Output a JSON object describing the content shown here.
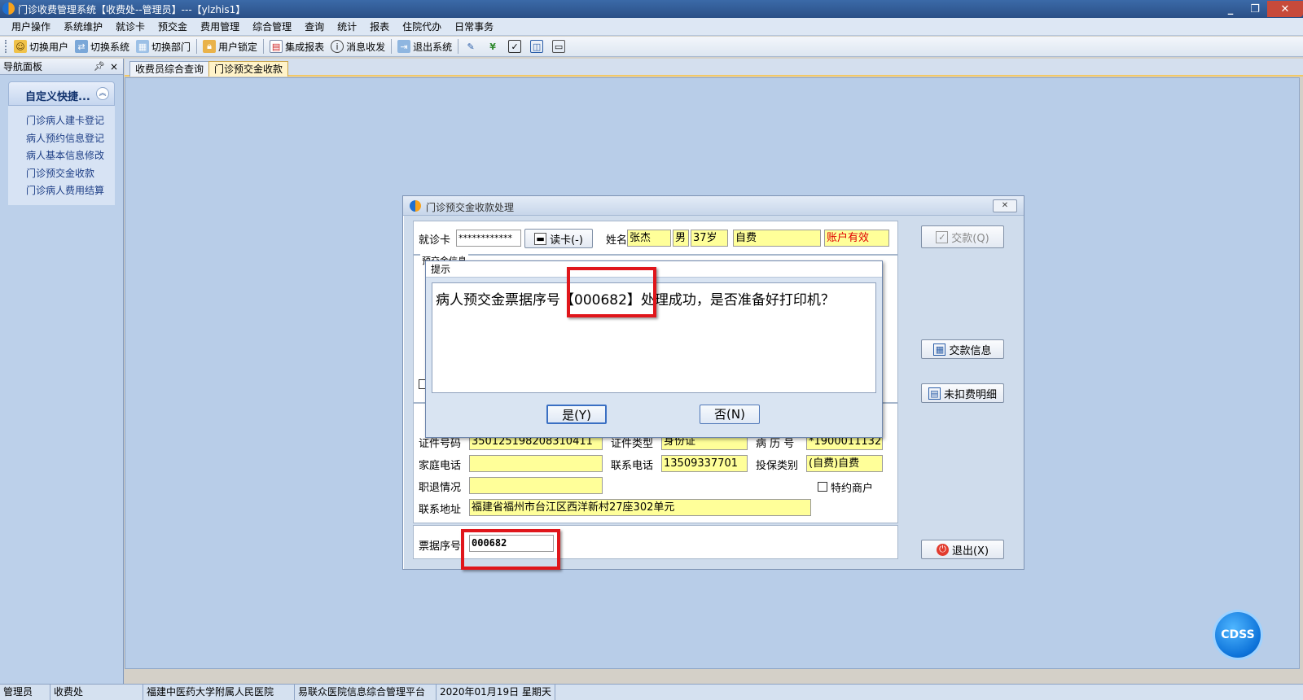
{
  "window": {
    "title": "门诊收费管理系统【收费处--管理员】---【ylzhis1】",
    "controls": [
      "minimize-icon",
      "restore-icon",
      "close-icon"
    ]
  },
  "menu": [
    "用户操作",
    "系统维护",
    "就诊卡",
    "预交金",
    "费用管理",
    "综合管理",
    "查询",
    "统计",
    "报表",
    "住院代办",
    "日常事务"
  ],
  "toolbar": {
    "switch_user": "切换用户",
    "switch_system": "切换系统",
    "switch_dept": "切换部门",
    "user_lock": "用户锁定",
    "integrated_report": "集成报表",
    "messages": "消息收发",
    "exit_system": "退出系统"
  },
  "nav": {
    "header": "导航面板",
    "pin": "♥",
    "close": "×",
    "group_title": "自定义快捷...",
    "items": [
      "门诊病人建卡登记",
      "病人预约信息登记",
      "病人基本信息修改",
      "门诊预交金收款",
      "门诊病人费用结算"
    ]
  },
  "tabs": [
    "收费员综合查询",
    "门诊预交金收款"
  ],
  "dialog": {
    "title": "门诊预交金收款处理",
    "card_label": "就诊卡",
    "card_value": "************",
    "read_card_button": "读卡(-)",
    "name_label": "姓名",
    "name_value": "张杰",
    "gender_value": "男",
    "age_value": "37岁",
    "pay_type_value": "自费",
    "account_status": "账户有效",
    "prepay_group_title": "预交金信息",
    "id_number_label": "证件号码",
    "id_number_value": "350125198208310411",
    "id_type_label": "证件类型",
    "id_type_value": "身份证",
    "record_no_label": "病 历 号",
    "record_no_value": "*1900011132",
    "home_phone_label": "家庭电话",
    "home_phone_value": "",
    "contact_phone_label": "联系电话",
    "contact_phone_value": "13509337701",
    "insurance_type_label": "投保类别",
    "insurance_type_value": "(自费)自费",
    "job_status_label": "职退情况",
    "job_status_value": "",
    "special_merchant_label": "特约商户",
    "address_label": "联系地址",
    "address_value": "福建省福州市台江区西洋新村27座302单元",
    "receipt_no_label": "票据序号",
    "receipt_no_value": "000682",
    "pay_button": "交款(Q)",
    "pay_info_button": "交款信息",
    "unpaid_detail_button": "未扣费明细",
    "exit_button": "退出(X)"
  },
  "msgbox": {
    "title": "提示",
    "message": "病人预交金票据序号【000682】处理成功，是否准备好打印机？",
    "yes_button": "是(Y)",
    "no_button": "否(N)"
  },
  "cdss": "CDSS",
  "status": {
    "user": "管理员",
    "dept": "收费处",
    "hospital": "福建中医药大学附属人民医院",
    "platform": "易联众医院信息综合管理平台",
    "date": "2020年01月19日 星期天"
  },
  "colors": {
    "highlight_red": "#e0161b",
    "field_yellow": "#ffff99",
    "account_status_red": "#e00000"
  }
}
